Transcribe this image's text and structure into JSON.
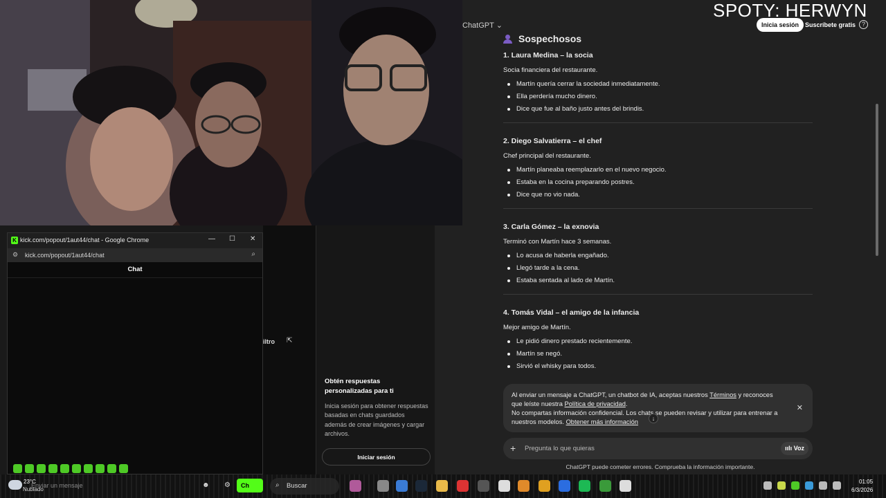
{
  "overlay": {
    "spoty": "SPOTY: HERWYN"
  },
  "gpt": {
    "model_label": "ChatGPT",
    "login_label": "Inicia sesión",
    "signup_label": "Suscríbete gratis",
    "section_title": "Sospechosos",
    "suspects": [
      {
        "title": "1. Laura Medina – la socia",
        "desc": "Socia financiera del restaurante.",
        "points": [
          "Martín quería cerrar la sociedad inmediatamente.",
          "Ella perdería mucho dinero.",
          "Dice que fue al baño justo antes del brindis."
        ]
      },
      {
        "title": "2. Diego Salvatierra – el chef",
        "desc": "Chef principal del restaurante.",
        "points": [
          "Martín planeaba reemplazarlo en el nuevo negocio.",
          "Estaba en la cocina preparando postres.",
          "Dice que no vio nada."
        ]
      },
      {
        "title": "3. Carla Gómez – la exnovia",
        "desc": "Terminó con Martín hace 3 semanas.",
        "points": [
          "Lo acusa de haberla engañado.",
          "Llegó tarde a la cena.",
          "Estaba sentada al lado de Martín."
        ]
      },
      {
        "title": "4. Tomás Vidal – el amigo de la infancia",
        "desc": "Mejor amigo de Martín.",
        "points": [
          "Le pidió dinero prestado recientemente.",
          "Martín se negó.",
          "Sirvió el whisky para todos."
        ]
      }
    ],
    "notice": {
      "part1": "Al enviar un mensaje a ChatGPT, un chatbot de IA, aceptas nuestros ",
      "terms": "Términos",
      "part2": " y reconoces que leíste nuestra ",
      "privacy": "Política de privacidad",
      "part3": ".",
      "line2": "No compartas información confidencial. Los chats se pueden revisar y utilizar para entrenar a nuestros modelos. ",
      "more": "Obtener más información"
    },
    "prompt_placeholder": "Pregunta lo que quieras",
    "voice_label": "Voz",
    "disclaimer": "ChatGPT puede cometer errores. Comprueba la información importante."
  },
  "midpanel": {
    "title": "Obtén respuestas personalizadas para ti",
    "body": "Inicia sesión para obtener respuestas basadas en chats guardados además de crear imágenes y cargar archivos.",
    "login_label": "Iniciar sesión",
    "filter_label": "iltro"
  },
  "chrome": {
    "window_title": "kick.com/popout/1aut44/chat - Google Chrome",
    "url": "kick.com/popout/1aut44/chat",
    "chat_title": "Chat",
    "message_placeholder": "Enviar un mensaje",
    "send_label": "Ch"
  },
  "taskbar": {
    "temperature": "23°C",
    "condition": "Nublado",
    "search_label": "Buscar",
    "time": "01:05",
    "date": "6/3/2026"
  }
}
